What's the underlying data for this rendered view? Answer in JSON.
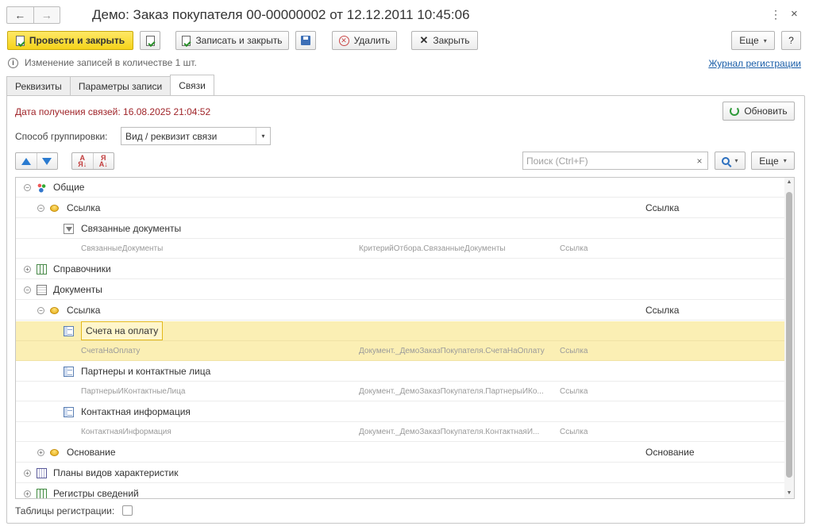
{
  "window": {
    "title": "Демо: Заказ покупателя 00-00000002 от 12.12.2011 10:45:06",
    "nav_back": "←",
    "nav_forward": "→",
    "menu_glyph": "⋮",
    "close_glyph": "×"
  },
  "toolbar": {
    "post_close": "Провести и закрыть",
    "write_close": "Записать и закрыть",
    "delete": "Удалить",
    "close": "Закрыть",
    "more": "Еще",
    "help": "?",
    "close_glyph": "✕",
    "delete_glyph": "✕",
    "caret": "▾"
  },
  "info": {
    "icon": "i",
    "message": "Изменение записей в количестве 1 шт.",
    "journal_link": "Журнал регистрации"
  },
  "tabs": [
    {
      "label": "Реквизиты"
    },
    {
      "label": "Параметры записи"
    },
    {
      "label": "Связи"
    }
  ],
  "links_panel": {
    "receive_date": "Дата получения связей: 16.08.2025 21:04:52",
    "refresh": "Обновить",
    "grouping_label": "Способ группировки:",
    "grouping_value": "Вид / реквизит связи",
    "search_placeholder": "Поиск (Ctrl+F)",
    "search_clear": "×",
    "more": "Еще",
    "caret": "▾",
    "checkbox_label": "Таблицы регистрации:"
  },
  "tree": {
    "rows": [
      {
        "toggle": "⊖",
        "label": "Общие",
        "right": ""
      },
      {
        "toggle": "⊖",
        "label": "Ссылка",
        "right": "Ссылка"
      },
      {
        "label": "Связанные документы"
      },
      {
        "col1": "СвязанныеДокументы",
        "col2": "КритерийОтбора.СвязанныеДокументы",
        "col3": "Ссылка"
      },
      {
        "toggle": "⊕",
        "label": "Справочники"
      },
      {
        "toggle": "⊖",
        "label": "Документы"
      },
      {
        "toggle": "⊖",
        "label": "Ссылка",
        "right": "Ссылка"
      },
      {
        "label": "Счета на оплату"
      },
      {
        "col1": "СчетаНаОплату",
        "col2": "Документ._ДемоЗаказПокупателя.СчетаНаОплату",
        "col3": "Ссылка"
      },
      {
        "label": "Партнеры и контактные лица"
      },
      {
        "col1": "ПартнерыИКонтактныеЛица",
        "col2": "Документ._ДемоЗаказПокупателя.ПартнерыИКо...",
        "col3": "Ссылка"
      },
      {
        "label": "Контактная информация"
      },
      {
        "col1": "КонтактнаяИнформация",
        "col2": "Документ._ДемоЗаказПокупателя.КонтактнаяИ...",
        "col3": "Ссылка"
      },
      {
        "toggle": "⊕",
        "label": "Основание",
        "right": "Основание"
      },
      {
        "toggle": "⊕",
        "label": "Планы видов характеристик"
      },
      {
        "toggle": "⊕",
        "label": "Регистры сведений"
      }
    ]
  },
  "scrollbar": {
    "up": "▲",
    "down": "▼"
  }
}
